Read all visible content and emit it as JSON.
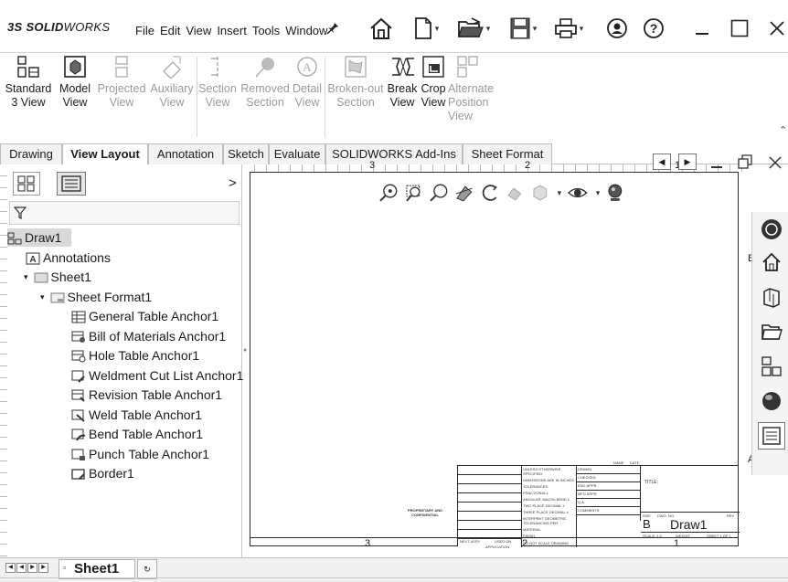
{
  "app": {
    "logo_brand": "SOLID",
    "logo_suffix": "WORKS",
    "logo_mark": "3S"
  },
  "menu": [
    "File",
    "Edit",
    "View",
    "Insert",
    "Tools",
    "Window"
  ],
  "quick_access": {
    "pin_icon": "pin-icon",
    "home_icon": "home-icon",
    "new_icon": "new-document-icon",
    "open_icon": "open-folder-icon",
    "save_icon": "save-icon",
    "print_icon": "print-icon",
    "user_icon": "user-icon",
    "help_icon": "help-icon"
  },
  "ribbon": {
    "standard_3view": "Standard\n3 View",
    "model_view": "Model\nView",
    "projected_view": "Projected\nView",
    "auxiliary_view": "Auxiliary\nView",
    "section_view": "Section\nView",
    "removed_section": "Removed\nSection",
    "detail_view": "Detail\nView",
    "broken_out_section": "Broken-out\nSection",
    "break_view": "Break\nView",
    "crop_view": "Crop\nView",
    "alternate_position_view": "Alternate\nPosition\nView"
  },
  "tabs": [
    "Drawing",
    "View Layout",
    "Annotation",
    "Sketch",
    "Evaluate",
    "SOLIDWORKS Add-Ins",
    "Sheet Format"
  ],
  "active_tab": "View Layout",
  "feature_manager": {
    "expand_arrow": ">",
    "root": "Draw1",
    "items": [
      "Annotations",
      "Sheet1",
      "Sheet Format1",
      "General Table Anchor1",
      "Bill of Materials Anchor1",
      "Hole Table Anchor1",
      "Weldment Cut List Anchor1",
      "Revision Table Anchor1",
      "Weld Table Anchor1",
      "Bend Table Anchor1",
      "Punch Table Anchor1",
      "Border1"
    ]
  },
  "sheet": {
    "zone_top_3": "3",
    "zone_top_2": "2",
    "zone_top_1": "1",
    "zone_bottom_3": "3",
    "zone_bottom_2": "2",
    "zone_bottom_1": "1",
    "zone_b": "B",
    "zone_a": "A",
    "title_label": "TITLE:",
    "size_label": "SIZE",
    "size_value": "B",
    "dwg_no_label": "DWG.  NO.",
    "dwg_no_value": "Draw1",
    "rev_label": "REV",
    "scale_label": "SCALE: 1:2",
    "weight_label": "WEIGHT:",
    "sheet_label": "SHEET 1 OF 1",
    "unless": "UNLESS OTHERWISE SPECIFIED:",
    "name_col": "NAME",
    "date_col": "DATE",
    "dims": "DIMENSIONS ARE IN INCHES",
    "tolerances": "TOLERANCES:",
    "fractional": "FRACTIONAL±",
    "angular": "ANGULAR: MACH±  BEND ±",
    "two_place": "TWO PLACE DECIMAL  ±",
    "three_place": "THREE PLACE DECIMAL  ±",
    "drawn": "DRAWN",
    "checked": "CHECKED",
    "eng_appr": "ENG APPR.",
    "mfg_appr": "MFG APPR.",
    "qa": "Q.A.",
    "comments": "COMMENTS:",
    "interpret": "INTERPRET GEOMETRIC TOLERANCING PER:",
    "material": "MATERIAL",
    "finish": "FINISH",
    "next_assy": "NEXT ASSY",
    "used_on": "USED ON",
    "application": "APPLICATION",
    "do_not_scale": "DO NOT SCALE DRAWING",
    "proprietary": "PROPRIETARY AND CONFIDENTIAL"
  },
  "bottom": {
    "sheet_tab": "Sheet1"
  },
  "colors": {
    "text": "#1a1a1a",
    "disabled": "#9a9a9a",
    "selected_row": "#d9d9d9",
    "border": "#2a2a2a"
  }
}
